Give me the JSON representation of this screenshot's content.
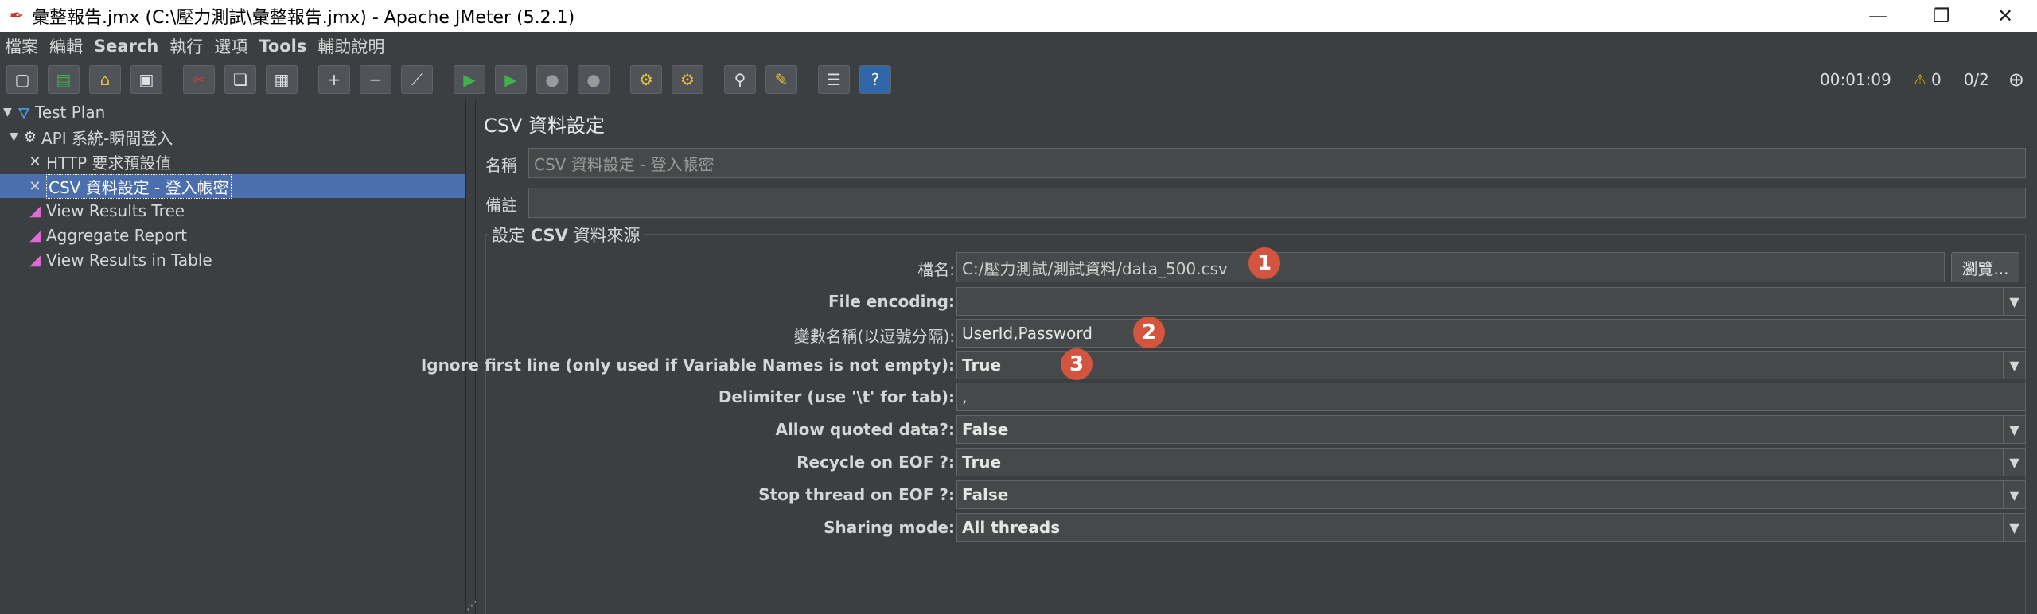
{
  "window": {
    "title": "彙整報告.jmx (C:\\壓力測試\\彙整報告.jmx) - Apache JMeter (5.2.1)",
    "controls": [
      "—",
      "❐",
      "✕"
    ]
  },
  "menu": {
    "items": [
      "檔案",
      "編輯",
      "Search",
      "執行",
      "選項",
      "Tools",
      "輔助說明"
    ]
  },
  "toolbar": {
    "timer": "00:01:09",
    "warnings": "0",
    "threads": "0/2"
  },
  "tree": {
    "items": [
      {
        "label": "Test Plan",
        "icon": "flask-icon"
      },
      {
        "label": "API 系統-瞬間登入",
        "icon": "gear-icon"
      },
      {
        "label": "HTTP 要求預設值",
        "icon": "tool-icon"
      },
      {
        "label": "CSV 資料設定 - 登入帳密",
        "icon": "tool-icon",
        "selected": true
      },
      {
        "label": "View Results Tree",
        "icon": "graph-icon"
      },
      {
        "label": "Aggregate Report",
        "icon": "graph-icon"
      },
      {
        "label": "View Results in Table",
        "icon": "graph-icon"
      }
    ]
  },
  "panel": {
    "title": "CSV 資料設定",
    "name_label": "名稱",
    "name_value": "CSV 資料設定 - 登入帳密",
    "comment_label": "備註",
    "comment_value": "",
    "group_title_prefix": "設定",
    "group_title_bold": "CSV",
    "group_title_suffix": "資料來源",
    "browse_label": "瀏覽...",
    "fields": [
      {
        "label": "檔名:",
        "value": "C:/壓力測試/測試資料/data_500.csv",
        "dropdown": false
      },
      {
        "label": "File encoding:",
        "value": "",
        "dropdown": true
      },
      {
        "label": "變數名稱(以逗號分隔):",
        "value": "UserId,Password",
        "dropdown": false
      },
      {
        "label": "Ignore first line (only used if Variable Names is not empty):",
        "value": "True",
        "dropdown": true
      },
      {
        "label": "Delimiter (use '\\t' for tab):",
        "value": ",",
        "dropdown": false
      },
      {
        "label": "Allow quoted data?:",
        "value": "False",
        "dropdown": true
      },
      {
        "label": "Recycle on EOF ?:",
        "value": "True",
        "dropdown": true
      },
      {
        "label": "Stop thread on EOF ?:",
        "value": "False",
        "dropdown": true
      },
      {
        "label": "Sharing mode:",
        "value": "All threads",
        "dropdown": true
      }
    ],
    "badges": [
      "1",
      "2",
      "3"
    ]
  }
}
